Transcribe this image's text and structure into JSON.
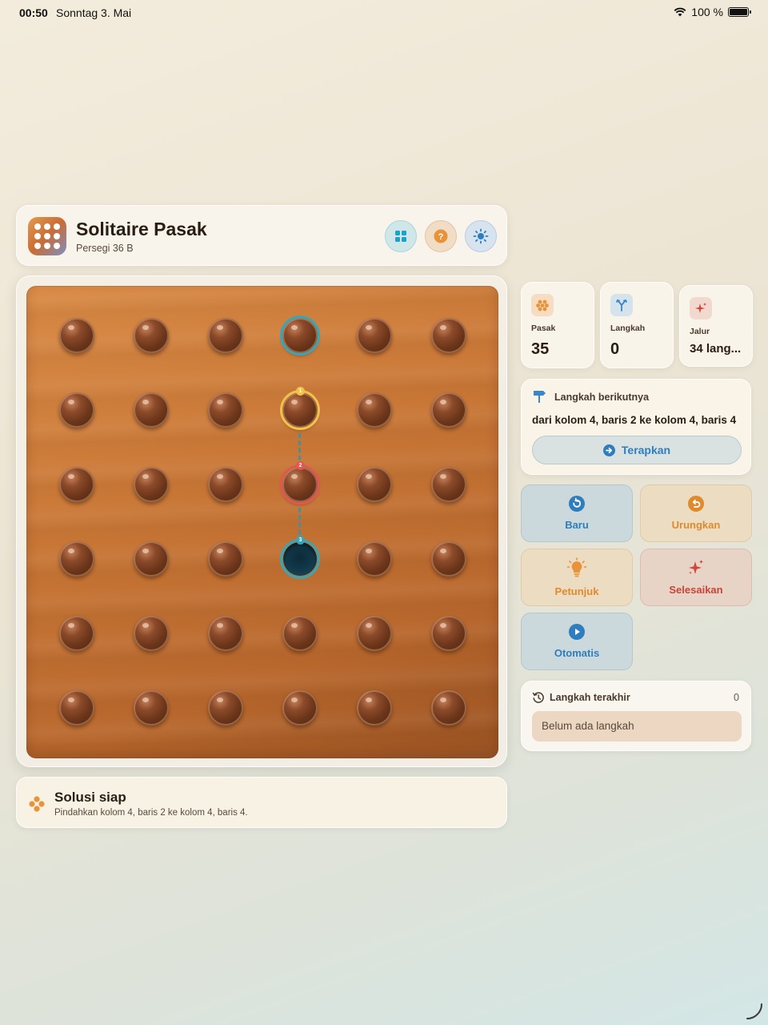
{
  "status_bar": {
    "time": "00:50",
    "date": "Sonntag 3. Mai",
    "battery": "100 %"
  },
  "header": {
    "title": "Solitaire Pasak",
    "subtitle": "Persegi 36 B"
  },
  "board": {
    "size": 6,
    "highlights": [
      {
        "col": 4,
        "row": 1,
        "type": "teal-ring"
      },
      {
        "col": 4,
        "row": 2,
        "type": "yellow-ring",
        "badge": "1"
      },
      {
        "col": 4,
        "row": 3,
        "type": "red-ring",
        "badge": "2"
      },
      {
        "col": 4,
        "row": 4,
        "type": "empty-hole",
        "badge": "3"
      }
    ]
  },
  "status": {
    "title": "Solusi siap",
    "description": "Pindahkan kolom 4, baris 2 ke kolom 4, baris 4."
  },
  "stats": [
    {
      "label": "Pasak",
      "value": "35",
      "icon": "pegs-icon",
      "color": "#e8923a"
    },
    {
      "label": "Langkah",
      "value": "0",
      "icon": "fork-icon",
      "color": "#3a86c8"
    },
    {
      "label": "Jalur",
      "value": "34 lang...",
      "icon": "sparkle-icon",
      "color": "#d0483c"
    }
  ],
  "next_move": {
    "heading": "Langkah berikutnya",
    "text": "dari kolom 4, baris 2 ke kolom 4, baris 4",
    "apply_label": "Terapkan"
  },
  "actions": {
    "new": "Baru",
    "undo": "Urungkan",
    "hint": "Petunjuk",
    "solve": "Selesaikan",
    "auto": "Otomatis"
  },
  "recent": {
    "title": "Langkah terakhir",
    "count": "0",
    "empty": "Belum ada langkah"
  },
  "colors": {
    "accent_blue": "#2e7dbf",
    "accent_orange": "#e08a2e",
    "accent_red": "#c8443a",
    "board_wood": "#c97736"
  }
}
